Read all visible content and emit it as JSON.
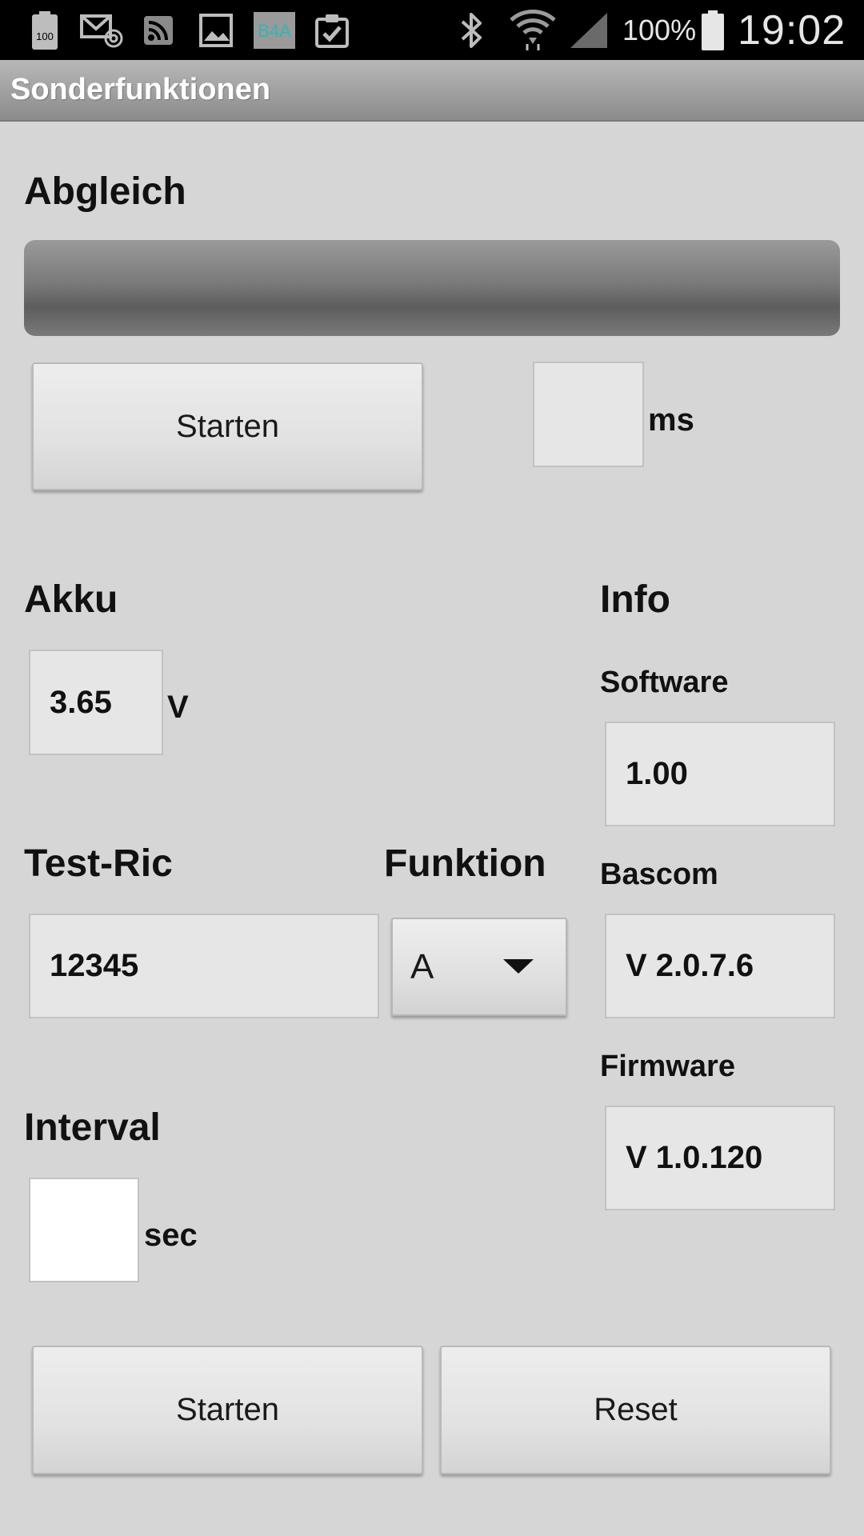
{
  "status_bar": {
    "icons": [
      "battery-100-icon",
      "mail-at-icon",
      "rss-icon",
      "image-icon",
      "b4a-icon",
      "clipboard-check-icon",
      "bluetooth-icon",
      "wifi-icon",
      "cell-signal-icon",
      "battery-icon"
    ],
    "battery_notification_label": "100",
    "b4a_label": "B4A",
    "battery_percent": "100%",
    "time": "19:02"
  },
  "title_bar": {
    "title": "Sonderfunktionen"
  },
  "abgleich": {
    "heading": "Abgleich",
    "progress_value": 0,
    "start_button": "Starten",
    "ms_value": "",
    "ms_unit": "ms"
  },
  "akku": {
    "heading": "Akku",
    "value": "3.65",
    "unit": "V"
  },
  "info": {
    "heading": "Info",
    "software_label": "Software",
    "software_value": "1.00",
    "bascom_label": "Bascom",
    "bascom_value": "V 2.0.7.6",
    "firmware_label": "Firmware",
    "firmware_value": "V 1.0.120"
  },
  "test_ric": {
    "heading": "Test-Ric",
    "value": "12345"
  },
  "funktion": {
    "heading": "Funktion",
    "selected": "A"
  },
  "interval": {
    "heading": "Interval",
    "value": "",
    "unit": "sec"
  },
  "footer": {
    "start_button": "Starten",
    "reset_button": "Reset"
  },
  "colors": {
    "background": "#d6d6d6",
    "title_bar": "#9e9e9e",
    "status_bar": "#000000",
    "field_bg": "#e6e6e6"
  }
}
